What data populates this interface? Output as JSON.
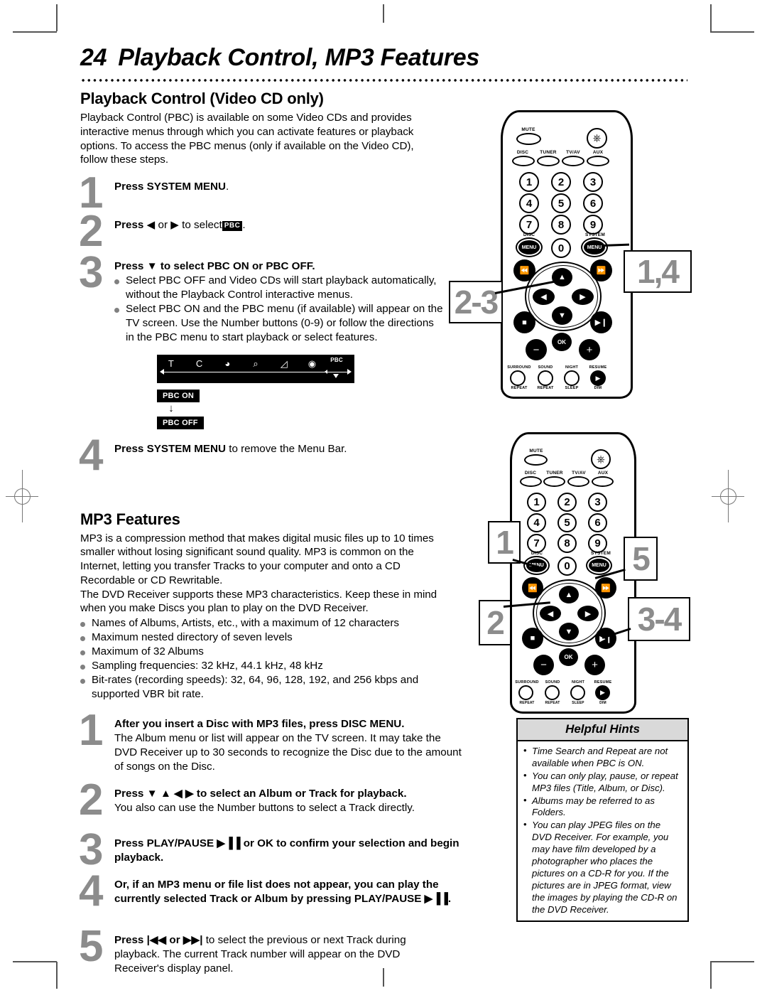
{
  "header": {
    "page_number": "24",
    "title": "Playback Control, MP3 Features"
  },
  "playback_control": {
    "heading": "Playback Control (Video CD only)",
    "intro": "Playback Control (PBC) is available on some Video CDs and provides interactive menus through which you can activate features or playback options. To access the PBC menus (only if available on the Video CD), follow these steps.",
    "steps": [
      {
        "num": "1",
        "bold": "Press SYSTEM MENU",
        "tail": "."
      },
      {
        "num": "2",
        "bold": "Press",
        "mid": "◀ or ▶ to select",
        "chip": "PBC",
        "tail": "."
      },
      {
        "num": "3",
        "bold": "Press ▼ to select PBC ON or PBC OFF.",
        "bullets": [
          "Select PBC OFF and Video CDs will start playback automatically, without the Playback Control interactive menus.",
          "Select PBC ON and the PBC menu (if available) will appear on the TV screen. Use the Number buttons (0-9) or follow the directions in the PBC menu to start playback or select features."
        ]
      },
      {
        "num": "4",
        "bold": "Press SYSTEM MENU",
        "tail": " to remove the Menu Bar."
      }
    ],
    "menu_bar": {
      "icons": [
        "T",
        "C",
        "spiral-icon",
        "zoom-icon",
        "angle-icon",
        "contrast-icon"
      ],
      "pbc_label": "PBC"
    },
    "pbc_toggle": {
      "on": "PBC ON",
      "arrow": "↓",
      "off": "PBC OFF"
    }
  },
  "mp3_features": {
    "heading": "MP3 Features",
    "para1": "MP3 is a compression method that makes digital music files up to 10 times smaller without losing significant sound quality. MP3 is common on the Internet, letting you transfer Tracks to your computer and onto a CD Recordable or CD Rewritable.",
    "para2": "The DVD Receiver supports these MP3 characteristics. Keep these in mind when you make Discs you plan to play on the DVD Receiver.",
    "bullets": [
      "Names of Albums, Artists, etc., with a maximum of 12 characters",
      "Maximum nested directory of seven levels",
      "Maximum of 32 Albums",
      "Sampling frequencies: 32 kHz, 44.1 kHz, 48 kHz",
      "Bit-rates (recording speeds): 32, 64, 96, 128, 192, and 256 kbps and supported VBR bit rate."
    ],
    "steps": [
      {
        "num": "1",
        "bold": "After you insert a Disc with MP3 files, press DISC MENU.",
        "sub": "The Album menu or list will appear on the TV screen. It may take the DVD Receiver up to 30 seconds to recognize the Disc due to the amount of songs on the Disc."
      },
      {
        "num": "2",
        "bold": "Press ▼ ▲ ◀ ▶ to select an Album or Track for playback.",
        "sub": "You also can use the Number buttons to select a Track directly."
      },
      {
        "num": "3",
        "bold": "Press PLAY/PAUSE ▶▐▐ or OK to confirm your selection and begin playback.",
        "sub": ""
      },
      {
        "num": "4",
        "bold": "Or, if an MP3 menu or file list does not appear, you can play the currently selected Track or Album by pressing PLAY/PAUSE ▶▐▐.",
        "sub": ""
      },
      {
        "num": "5",
        "bold": "Press |◀◀ or ▶▶|",
        "sub": "to select the previous or next Track during playback. The current Track number will appear on the DVD Receiver's display panel."
      }
    ]
  },
  "hints": {
    "title": "Helpful Hints",
    "items": [
      "Time Search and Repeat are not available when PBC is ON.",
      "You can only play, pause, or repeat MP3 files (Title, Album, or Disc).",
      "Albums may be referred to as Folders.",
      "You can play JPEG files on the DVD Receiver. For example, you may have film developed by a photographer who places the pictures on a CD-R for you. If the pictures are in JPEG format, view the images by playing the CD-R on the DVD Receiver."
    ]
  },
  "remote_top": {
    "callouts": {
      "left": "2-3",
      "right": "1,4"
    },
    "labels": {
      "mute": "MUTE",
      "disc": "DISC",
      "tuner": "TUNER",
      "tvav": "TV/AV",
      "aux": "AUX",
      "disc_menu": "DISC",
      "system_menu": "SYSTEM",
      "menu_btn": "MENU",
      "ok": "OK",
      "surround": "SURROUND",
      "sound": "SOUND",
      "night": "NIGHT",
      "resume": "RESUME",
      "repeat1": "REPEAT",
      "repeat2": "REPEAT",
      "sleep": "SLEEP",
      "dim": "DIM"
    },
    "numbers": [
      "1",
      "2",
      "3",
      "4",
      "5",
      "6",
      "7",
      "8",
      "9",
      "0"
    ]
  },
  "remote_bottom": {
    "callouts": {
      "left_top": "1",
      "left_bottom": "2",
      "right_top": "5",
      "right_bottom": "3-4"
    },
    "labels": {
      "mute": "MUTE",
      "disc": "DISC",
      "tuner": "TUNER",
      "tvav": "TV/AV",
      "aux": "AUX",
      "disc_menu": "DISC",
      "system_menu": "SYSTEM",
      "menu_btn": "MENU",
      "ok": "OK",
      "surround": "SURROUND",
      "sound": "SOUND",
      "night": "NIGHT",
      "resume": "RESUME",
      "repeat1": "REPEAT",
      "repeat2": "REPEAT",
      "sleep": "SLEEP",
      "dim": "DIM"
    },
    "numbers": [
      "1",
      "2",
      "3",
      "4",
      "5",
      "6",
      "7",
      "8",
      "9",
      "0"
    ]
  },
  "colors": {
    "step_number": "#8c8c8c",
    "hints_header_bg": "#d9d9d9",
    "bullet": "#808080"
  }
}
